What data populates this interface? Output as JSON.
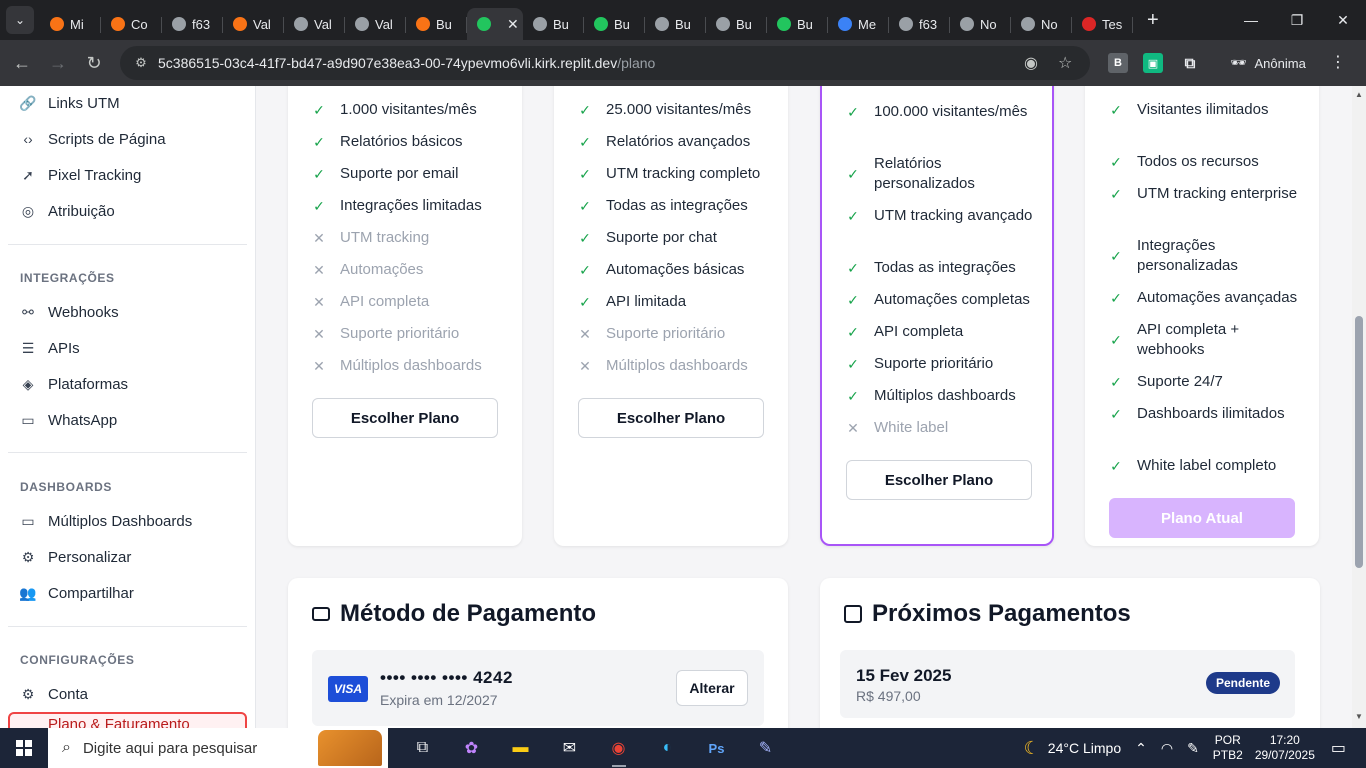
{
  "browser": {
    "tabs": [
      {
        "label": "Mi",
        "favicon_color": "#f97316"
      },
      {
        "label": "Co",
        "favicon_color": "#f97316"
      },
      {
        "label": "f63",
        "favicon_color": "#9aa0a6"
      },
      {
        "label": "Val",
        "favicon_color": "#f97316"
      },
      {
        "label": "Val",
        "favicon_color": "#9aa0a6"
      },
      {
        "label": "Val",
        "favicon_color": "#9aa0a6"
      },
      {
        "label": "Bu",
        "favicon_color": "#f97316"
      },
      {
        "label": "",
        "favicon_color": "#22c55e"
      },
      {
        "label": "Bu",
        "favicon_color": "#9aa0a6"
      },
      {
        "label": "Bu",
        "favicon_color": "#22c55e"
      },
      {
        "label": "Bu",
        "favicon_color": "#9aa0a6"
      },
      {
        "label": "Bu",
        "favicon_color": "#9aa0a6"
      },
      {
        "label": "Bu",
        "favicon_color": "#22c55e"
      },
      {
        "label": "Me",
        "favicon_color": "#3b82f6"
      },
      {
        "label": "f63",
        "favicon_color": "#9aa0a6"
      },
      {
        "label": "No",
        "favicon_color": "#9aa0a6"
      },
      {
        "label": "No",
        "favicon_color": "#9aa0a6"
      },
      {
        "label": "Tes",
        "favicon_color": "#dc2626"
      }
    ],
    "active_tab_index": 7,
    "url_host": "5c386515-03c4-41f7-bd47-a9d907e38ea3-00-74ypevmo6vli.kirk.replit.dev",
    "url_path": "/plano",
    "incognito_label": "Anônima"
  },
  "sidebar": {
    "top_items": [
      {
        "label": "Links UTM",
        "icon": "link-icon",
        "glyph": "🔗"
      },
      {
        "label": "Scripts de Página",
        "icon": "code-icon",
        "glyph": "‹›"
      },
      {
        "label": "Pixel Tracking",
        "icon": "cursor-icon",
        "glyph": "➚"
      },
      {
        "label": "Atribuição",
        "icon": "target-icon",
        "glyph": "◎"
      }
    ],
    "integrations_title": "INTEGRAÇÕES",
    "integrations": [
      {
        "label": "Webhooks",
        "icon": "webhook-icon",
        "glyph": "⚯"
      },
      {
        "label": "APIs",
        "icon": "database-icon",
        "glyph": "☰"
      },
      {
        "label": "Plataformas",
        "icon": "layers-icon",
        "glyph": "◈"
      },
      {
        "label": "WhatsApp",
        "icon": "message-icon",
        "glyph": "▭"
      }
    ],
    "dashboards_title": "DASHBOARDS",
    "dashboards": [
      {
        "label": "Múltiplos Dashboards",
        "icon": "monitor-icon",
        "glyph": "▭"
      },
      {
        "label": "Personalizar",
        "icon": "settings-icon",
        "glyph": "⚙"
      },
      {
        "label": "Compartilhar",
        "icon": "users-icon",
        "glyph": "👥"
      }
    ],
    "settings_title": "CONFIGURAÇÕES",
    "settings": [
      {
        "label": "Conta",
        "icon": "gear-icon",
        "glyph": "⚙"
      }
    ],
    "active_label": "Plano & Faturamento"
  },
  "plans": [
    {
      "features": [
        {
          "text": "1.000 visitantes/mês",
          "included": true
        },
        {
          "text": "Relatórios básicos",
          "included": true
        },
        {
          "text": "Suporte por email",
          "included": true
        },
        {
          "text": "Integrações limitadas",
          "included": true
        },
        {
          "text": "UTM tracking",
          "included": false
        },
        {
          "text": "Automações",
          "included": false
        },
        {
          "text": "API completa",
          "included": false
        },
        {
          "text": "Suporte prioritário",
          "included": false
        },
        {
          "text": "Múltiplos dashboards",
          "included": false
        }
      ],
      "button": "Escolher Plano",
      "current": false,
      "featured": false
    },
    {
      "features": [
        {
          "text": "25.000 visitantes/mês",
          "included": true
        },
        {
          "text": "Relatórios avançados",
          "included": true
        },
        {
          "text": "UTM tracking completo",
          "included": true
        },
        {
          "text": "Todas as integrações",
          "included": true
        },
        {
          "text": "Suporte por chat",
          "included": true
        },
        {
          "text": "Automações básicas",
          "included": true
        },
        {
          "text": "API limitada",
          "included": true
        },
        {
          "text": "Suporte prioritário",
          "included": false
        },
        {
          "text": "Múltiplos dashboards",
          "included": false
        }
      ],
      "button": "Escolher Plano",
      "current": false,
      "featured": false
    },
    {
      "features": [
        {
          "text": "100.000 visitantes/mês",
          "included": true
        },
        {
          "text": "Relatórios personalizados",
          "included": true
        },
        {
          "text": "UTM tracking avançado",
          "included": true
        },
        {
          "text": "Todas as integrações",
          "included": true
        },
        {
          "text": "Automações completas",
          "included": true
        },
        {
          "text": "API completa",
          "included": true
        },
        {
          "text": "Suporte prioritário",
          "included": true
        },
        {
          "text": "Múltiplos dashboards",
          "included": true
        },
        {
          "text": "White label",
          "included": false
        }
      ],
      "button": "Escolher Plano",
      "current": false,
      "featured": true
    },
    {
      "features": [
        {
          "text": "Visitantes ilimitados",
          "included": true
        },
        {
          "text": "Todos os recursos",
          "included": true
        },
        {
          "text": "UTM tracking enterprise",
          "included": true
        },
        {
          "text": "Integrações personalizadas",
          "included": true
        },
        {
          "text": "Automações avançadas",
          "included": true
        },
        {
          "text": "API completa + webhooks",
          "included": true
        },
        {
          "text": "Suporte 24/7",
          "included": true
        },
        {
          "text": "Dashboards ilimitados",
          "included": true
        },
        {
          "text": "White label completo",
          "included": true
        }
      ],
      "button": "Plano Atual",
      "current": true,
      "featured": false
    }
  ],
  "payment_method": {
    "title": "Método de Pagamento",
    "brand": "VISA",
    "number": "•••• •••• •••• 4242",
    "expiry": "Expira em 12/2027",
    "change_label": "Alterar"
  },
  "upcoming_payments": {
    "title": "Próximos Pagamentos",
    "items": [
      {
        "date": "15 Fev 2025",
        "amount": "R$ 497,00",
        "status": "Pendente"
      }
    ]
  },
  "taskbar": {
    "search_placeholder": "Digite aqui para pesquisar",
    "weather": "24°C  Limpo",
    "lang_1": "POR",
    "lang_2": "PTB2",
    "time": "17:20",
    "date": "29/07/2025"
  },
  "colors": {
    "accent": "#a855f7",
    "current_plan_button": "#d8b4fe",
    "check": "#16a34a",
    "badge": "#1e3a8a",
    "visa": "#1d4ed8"
  }
}
